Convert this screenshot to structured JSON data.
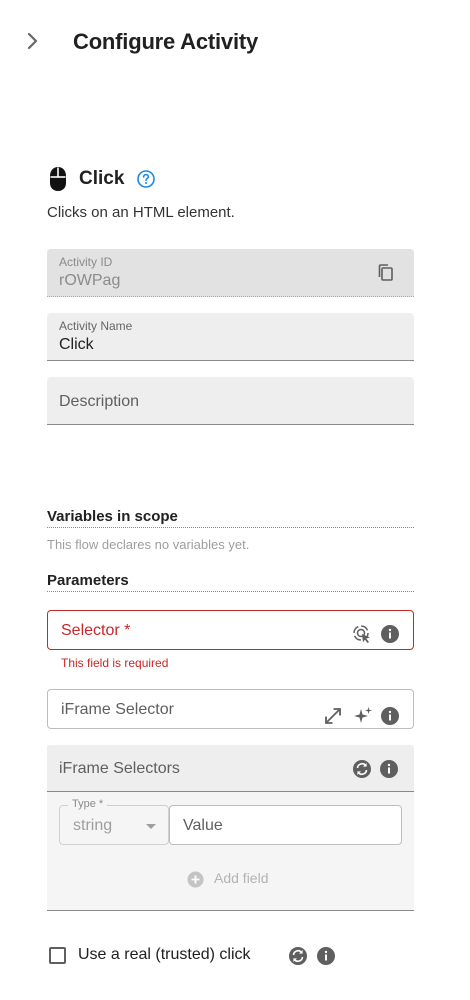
{
  "header": {
    "collapse_icon": "chevron-right-icon",
    "title": "Configure Activity"
  },
  "activity": {
    "icon": "mouse-icon",
    "name": "Click",
    "help_icon": "help-circle-icon",
    "description": "Clicks on an HTML element."
  },
  "fields": {
    "activity_id": {
      "label": "Activity ID",
      "value": "rOWPag",
      "action_icon": "copy-icon"
    },
    "activity_name": {
      "label": "Activity Name",
      "value": "Click"
    },
    "description": {
      "placeholder": "Description"
    }
  },
  "variables": {
    "title": "Variables in scope",
    "empty_text": "This flow declares no variables yet."
  },
  "parameters": {
    "title": "Parameters",
    "selector": {
      "label": "Selector *",
      "error": "This field is required",
      "icons": [
        "element-picker-icon",
        "info-icon"
      ]
    },
    "iframe_selector": {
      "label": "iFrame Selector",
      "icons": [
        "expand-icon",
        "sparkle-icon",
        "info-icon"
      ]
    },
    "iframe_selectors": {
      "label": "iFrame Selectors",
      "icons": [
        "refresh-icon",
        "info-icon"
      ],
      "row": {
        "type_label": "Type *",
        "type_value": "string",
        "value_placeholder": "Value"
      },
      "add_field_label": "Add field"
    },
    "trusted_click": {
      "label": "Use a real (trusted) click",
      "checked": false,
      "icons": [
        "refresh-icon",
        "info-icon"
      ]
    }
  },
  "colors": {
    "error": "#c62828",
    "accent": "#1976d2",
    "field_bg": "#eeeeee",
    "icon": "#5f5f5f"
  }
}
